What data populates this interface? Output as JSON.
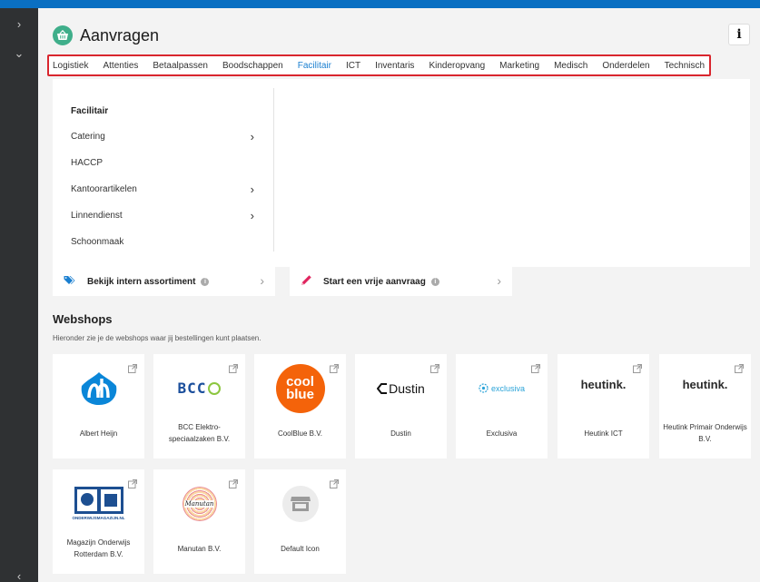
{
  "header": {
    "title": "Aanvragen",
    "info_label": "i"
  },
  "tabs": [
    "Logistiek",
    "Attenties",
    "Betaalpassen",
    "Boodschappen",
    "Facilitair",
    "ICT",
    "Inventaris",
    "Kinderopvang",
    "Marketing",
    "Medisch",
    "Onderdelen",
    "Technisch"
  ],
  "active_tab": "Facilitair",
  "dropdown": {
    "heading": "Facilitair",
    "items": [
      {
        "label": "Catering",
        "has_sub": true
      },
      {
        "label": "HACCP",
        "has_sub": false
      },
      {
        "label": "Kantoorartikelen",
        "has_sub": true
      },
      {
        "label": "Linnendienst",
        "has_sub": true
      },
      {
        "label": "Schoonmaak",
        "has_sub": false
      }
    ]
  },
  "actions": {
    "intern": "Bekijk intern assortiment",
    "vrije": "Start een vrije aanvraag"
  },
  "webshops": {
    "title": "Webshops",
    "subtitle": "Hieronder zie je de webshops waar jij bestellingen kunt plaatsen.",
    "cards": [
      {
        "name": "Albert Heijn",
        "logo": "ah-logo"
      },
      {
        "name": "BCC Elektro-speciaalzaken B.V.",
        "logo": "bcc-logo",
        "logo_text": "BCC"
      },
      {
        "name": "CoolBlue  B.V.",
        "logo": "coolblue-logo",
        "logo_text_1": "cool",
        "logo_text_2": "blue"
      },
      {
        "name": "Dustin",
        "logo": "dustin-logo",
        "logo_text": "Dustin"
      },
      {
        "name": "Exclusiva",
        "logo": "exclusiva-logo",
        "logo_text": "exclusiva"
      },
      {
        "name": "Heutink ICT",
        "logo": "heutink-logo",
        "logo_text": "heutink."
      },
      {
        "name": "Heutink Primair Onderwijs B.V.",
        "logo": "heutink-logo",
        "logo_text": "heutink."
      },
      {
        "name": "Magazijn Onderwijs Rotterdam B.V.",
        "logo": "onderwijsmagazijn-logo",
        "logo_text": "ONDERWIJSMAGAZIJN.NL"
      },
      {
        "name": "Manutan B.V.",
        "logo": "manutan-logo",
        "logo_text": "Manutan"
      },
      {
        "name": "Default Icon",
        "logo": "store-icon"
      }
    ]
  },
  "colors": {
    "accent": "#1a7fd0",
    "topbar": "#0a6fc2",
    "sidebar": "#2f3133",
    "highlight": "#d9262e",
    "basket": "#3fae8a",
    "coolblue": "#f4630a",
    "ah": "#0a86d8"
  }
}
